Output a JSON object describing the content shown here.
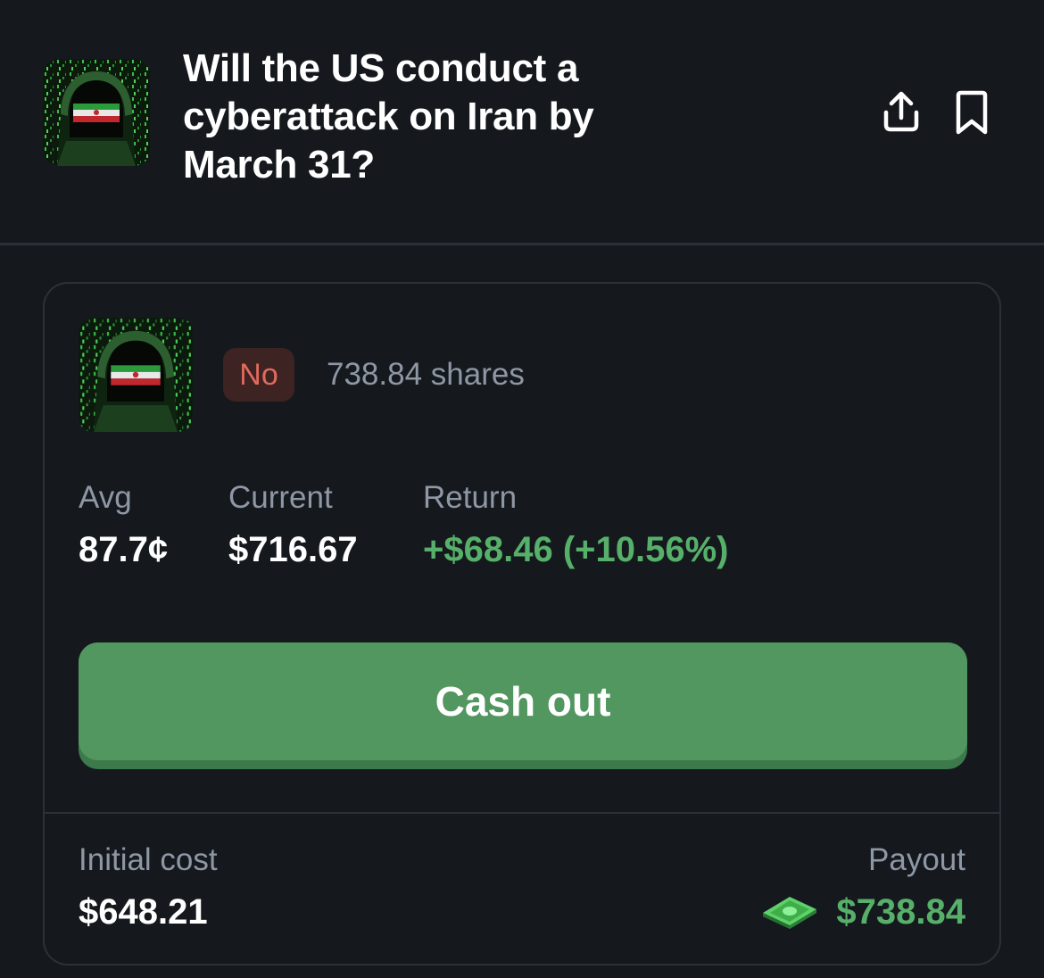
{
  "market": {
    "title": "Will the US conduct a cyberattack on Iran by March 31?",
    "thumbnail_icon": "hooded-hacker-iran-flag-image"
  },
  "header_actions": {
    "share_icon": "share-icon",
    "bookmark_icon": "bookmark-icon"
  },
  "position": {
    "outcome": "No",
    "shares": "738.84 shares",
    "stats": {
      "avg_label": "Avg",
      "avg_value": "87.7¢",
      "current_label": "Current",
      "current_value": "$716.67",
      "return_label": "Return",
      "return_value": "+$68.46 (+10.56%)"
    },
    "cash_out_label": "Cash out",
    "footer": {
      "initial_cost_label": "Initial cost",
      "initial_cost_value": "$648.21",
      "payout_label": "Payout",
      "payout_value": "$738.84",
      "payout_icon": "money-bill-icon"
    }
  },
  "colors": {
    "background": "#15191e",
    "accent_green": "#529660",
    "positive_text": "#57b06a",
    "no_badge_bg": "#3d2322",
    "no_badge_text": "#e06a5e",
    "muted_text": "#8e97a4"
  }
}
